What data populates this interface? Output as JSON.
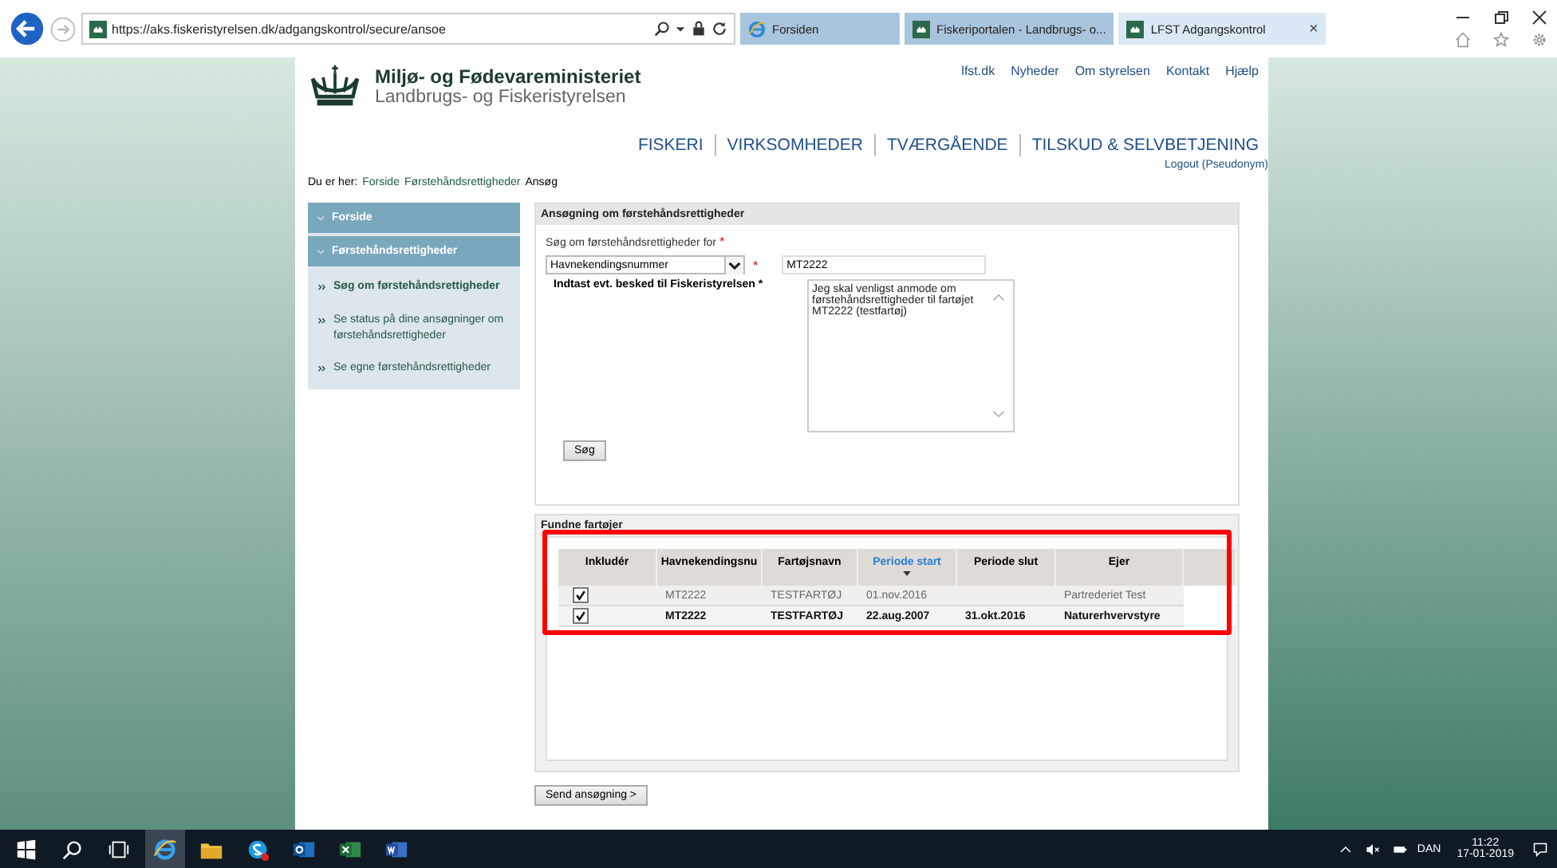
{
  "browser": {
    "url": "https://aks.fiskeristyrelsen.dk/adgangskontrol/secure/ansoe",
    "tabs": [
      {
        "label": "Forsiden",
        "selected": false
      },
      {
        "label": "Fiskeriportalen - Landbrugs- o...",
        "selected": false
      },
      {
        "label": "LFST Adgangskontrol",
        "selected": true,
        "close": "×"
      }
    ]
  },
  "header": {
    "ministry": "Miljø- og Fødevareministeriet",
    "agency": "Landbrugs- og Fiskeristyrelsen",
    "top_links": [
      "lfst.dk",
      "Nyheder",
      "Om styrelsen",
      "Kontakt",
      "Hjælp"
    ],
    "main_nav": [
      "FISKERI",
      "VIRKSOMHEDER",
      "TVÆRGÅENDE",
      "TILSKUD & SELVBETJENING"
    ],
    "logout": "Logout (Pseudonym)"
  },
  "breadcrumb": {
    "label": "Du er her:",
    "links": [
      "Forside",
      "Førstehåndsrettigheder"
    ],
    "current": "Ansøg"
  },
  "sidebar": {
    "items": [
      {
        "kind": "section",
        "label": "Forside",
        "selected": false
      },
      {
        "kind": "section",
        "label": "Førstehåndsrettigheder",
        "selected": false
      },
      {
        "kind": "link",
        "label": "Søg om førstehåndsrettigheder",
        "selected": true
      },
      {
        "kind": "link",
        "label": "Se status på dine ansøgninger om førstehåndsrettigheder",
        "selected": false
      },
      {
        "kind": "link",
        "label": "Se egne førstehåndsrettigheder",
        "selected": false
      }
    ]
  },
  "form": {
    "title": "Ansøgning om førstehåndsrettigheder",
    "search_label": "Søg om førstehåndsrettigheder for",
    "required": "*",
    "type_select": "Havnekendingsnummer",
    "number_value": "MT2222",
    "message_label": "Indtast evt. besked til Fiskeristyrelsen *",
    "message_value": "Jeg skal venligst anmode om førstehåndsrettigheder til fartøjet MT2222 (testfartøj)",
    "search_button": "Søg"
  },
  "results": {
    "title": "Fundne fartøjer",
    "columns": [
      {
        "label": "Inkludér",
        "sorted": false
      },
      {
        "label": "Havnekendingsnu",
        "sorted": false
      },
      {
        "label": "Fartøjsnavn",
        "sorted": false
      },
      {
        "label": "Periode start",
        "sorted": true
      },
      {
        "label": "Periode slut",
        "sorted": false
      },
      {
        "label": "Ejer",
        "sorted": false
      }
    ],
    "rows": [
      {
        "checked": true,
        "bold": false,
        "cells": [
          "",
          "MT2222",
          "TESTFARTØJ",
          "01.nov.2016",
          "",
          "Partrederiet Test"
        ]
      },
      {
        "checked": true,
        "bold": true,
        "cells": [
          "",
          "MT2222",
          "TESTFARTØJ",
          "22.aug.2007",
          "31.okt.2016",
          "Naturerhvervstyre"
        ]
      }
    ]
  },
  "send_button": "Send ansøgning >",
  "taskbar": {
    "language": "DAN",
    "time": "11:22",
    "date": "17-01-2019"
  }
}
